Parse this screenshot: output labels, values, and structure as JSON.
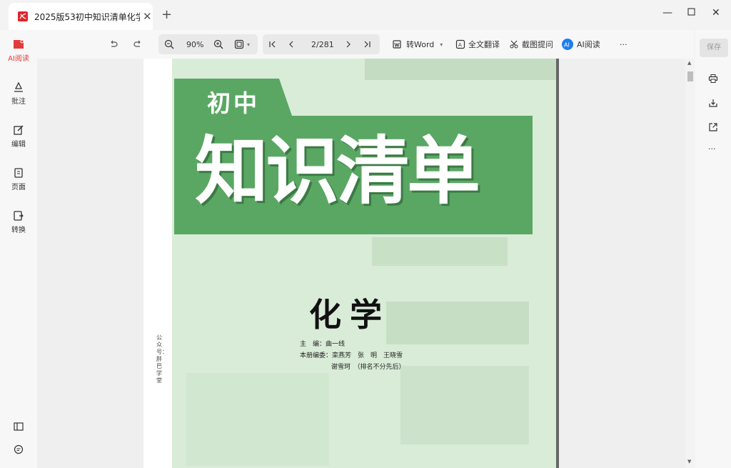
{
  "tab": {
    "title": "2025版53初中知识清单化学...",
    "icon": "pdf-icon"
  },
  "toolbar": {
    "zoom": "90%",
    "page_indicator": "2/281",
    "to_word": "转Word",
    "translate": "全文翻译",
    "screenshot_ask": "截图提问",
    "ai_read": "AI阅读",
    "more": "···"
  },
  "sidebar": {
    "items": [
      {
        "label": "AI阅读",
        "icon": "ai-read-icon",
        "active": true
      },
      {
        "label": "批注",
        "icon": "annotate-icon"
      },
      {
        "label": "编辑",
        "icon": "edit-icon"
      },
      {
        "label": "页面",
        "icon": "pages-icon"
      },
      {
        "label": "转换",
        "icon": "convert-icon"
      }
    ]
  },
  "rightbar": {
    "save": "保存",
    "more": "···"
  },
  "document": {
    "badge": "初中",
    "title": "知识清单",
    "subject": "化学",
    "editor_label": "主　编：",
    "editor": "曲一线",
    "board_label": "本册编委：",
    "board_line1": "栾燕芳　张　明　王晓雪",
    "board_line2": "谢雪珂　（排名不分先后）",
    "side_vertical": "公众号：胖巴学堂"
  },
  "colors": {
    "accent_red": "#e23b3b",
    "cover_green": "#5aa763",
    "cover_bg": "#d9ecd8",
    "ai_blue": "#1e7ef0"
  }
}
